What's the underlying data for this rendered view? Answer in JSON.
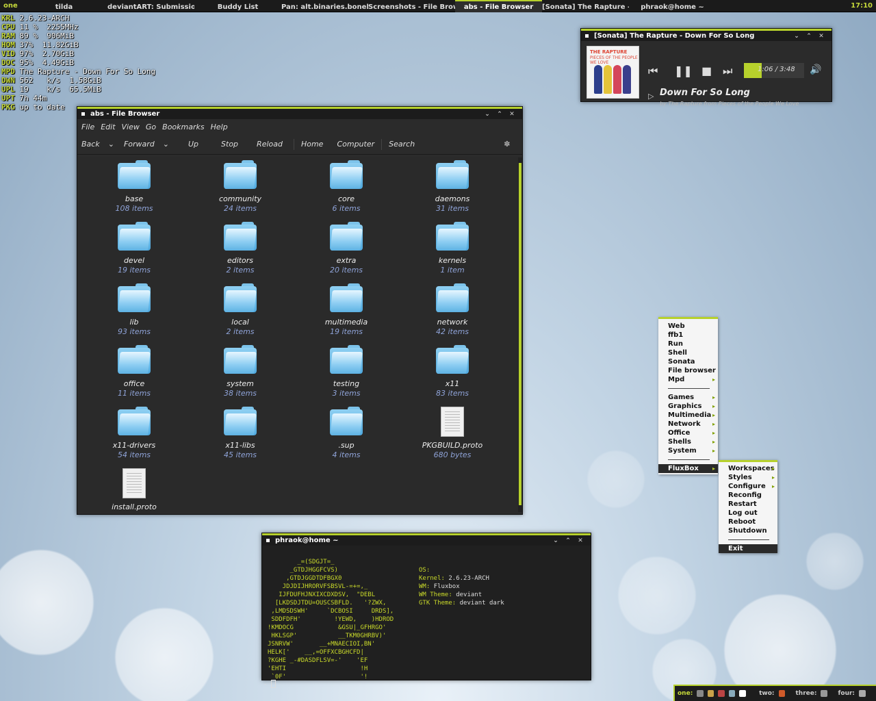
{
  "taskbar": {
    "workspace": "one",
    "tasks": [
      {
        "label": "tilda"
      },
      {
        "label": "deviantART: Submission -"
      },
      {
        "label": "Buddy List"
      },
      {
        "label": "Pan: alt.binaries.boneless"
      },
      {
        "label": "Screenshots - File Browser"
      },
      {
        "label": "abs - File Browser"
      },
      {
        "label": "[Sonata] The Rapture - Do"
      },
      {
        "label": "phraok@home ~"
      }
    ],
    "active_task": 5,
    "clock": "17:10",
    "accent": "#b7d12c"
  },
  "conky": [
    {
      "key": "KRL",
      "val": "2.6.23-ARCH"
    },
    {
      "key": "CPU",
      "val": "11 %  2255MHz"
    },
    {
      "key": "RAM",
      "val": "89 %  906MiB"
    },
    {
      "key": "HOM",
      "val": "37%  11.82GiB"
    },
    {
      "key": "VID",
      "val": "97%  2.70GiB"
    },
    {
      "key": "DOC",
      "val": "95%  4.49GiB"
    },
    {
      "key": "MPD",
      "val": "The Rapture - Down For So Long"
    },
    {
      "key": "DWN",
      "val": "562   k/s  1.58GiB"
    },
    {
      "key": "UPL",
      "val": "19    k/s  65.5MiB"
    },
    {
      "key": "UPT",
      "val": "7h 44m"
    },
    {
      "key": "PKG",
      "val": "up to date"
    }
  ],
  "file_browser": {
    "title": "abs - File Browser",
    "menu": [
      "File",
      "Edit",
      "View",
      "Go",
      "Bookmarks",
      "Help"
    ],
    "toolbar": {
      "back": "Back",
      "forward": "Forward",
      "up": "Up",
      "stop": "Stop",
      "reload": "Reload",
      "home": "Home",
      "computer": "Computer",
      "search": "Search"
    },
    "items": [
      {
        "name": "base",
        "count": "108 items",
        "type": "folder"
      },
      {
        "name": "community",
        "count": "24 items",
        "type": "folder"
      },
      {
        "name": "core",
        "count": "6 items",
        "type": "folder"
      },
      {
        "name": "daemons",
        "count": "31 items",
        "type": "folder"
      },
      {
        "name": "devel",
        "count": "19 items",
        "type": "folder"
      },
      {
        "name": "editors",
        "count": "2 items",
        "type": "folder"
      },
      {
        "name": "extra",
        "count": "20 items",
        "type": "folder"
      },
      {
        "name": "kernels",
        "count": "1 item",
        "type": "folder"
      },
      {
        "name": "lib",
        "count": "93 items",
        "type": "folder"
      },
      {
        "name": "local",
        "count": "2 items",
        "type": "folder"
      },
      {
        "name": "multimedia",
        "count": "19 items",
        "type": "folder"
      },
      {
        "name": "network",
        "count": "42 items",
        "type": "folder"
      },
      {
        "name": "office",
        "count": "11 items",
        "type": "folder"
      },
      {
        "name": "system",
        "count": "38 items",
        "type": "folder"
      },
      {
        "name": "testing",
        "count": "3 items",
        "type": "folder"
      },
      {
        "name": "x11",
        "count": "83 items",
        "type": "folder"
      },
      {
        "name": "x11-drivers",
        "count": "54 items",
        "type": "folder"
      },
      {
        "name": "x11-libs",
        "count": "45 items",
        "type": "folder"
      },
      {
        "name": ".sup",
        "count": "4 items",
        "type": "folder"
      },
      {
        "name": "PKGBUILD.proto",
        "count": "680 bytes",
        "type": "file"
      },
      {
        "name": "install.proto",
        "count": "",
        "type": "file"
      }
    ]
  },
  "sonata": {
    "title": "[Sonata] The Rapture - Down For So Long",
    "time": "1:06 / 3:48",
    "progress_fraction": 0.29,
    "song": "Down For So Long",
    "sub": "by The Rapture from Pieces of the People We Love",
    "art_band": "THE RAPTURE",
    "art_album": "PIECES OF THE PEOPLE WE LOVE"
  },
  "terminal": {
    "title": "phraok@home ~",
    "ascii": [
      "        _=(SDGJT=_",
      "      _GTDJHGGFCVS)",
      "     ,GTDJGGDTDFBGX0",
      "    JDJDIJHRORVFSBSVL-=+=,_",
      "   IJFDUFHJNXIXCDXDSV,  \"DEBL",
      "  [LKDSDJTDU=OUSCSBFLD.   '?ZWX,",
      " ,LMDSDSWH'     `DCBOSI     DRDS],",
      " SDDFDFH'         !YEWD,    )HDROD",
      "!KMDOCG            &GSU|_GFHRGO'",
      " HKLSGP'           __TKM0GHRBV)'",
      "JSNRVW'       __+MNAECIOI,BN'",
      "HELK['    __,=OFFXCBGHCFD|",
      "?KGHE _-#DASDFLSV=-'    'EF",
      "'EHTI                    !H",
      " `0F'                    '!"
    ],
    "info": [
      {
        "label": "OS:",
        "value": ""
      },
      {
        "label": "Kernel:",
        "value": "2.6.23-ARCH"
      },
      {
        "label": "WM:",
        "value": "Fluxbox"
      },
      {
        "label": "WM Theme:",
        "value": "deviant"
      },
      {
        "label": "GTK Theme:",
        "value": "deviant dark"
      }
    ],
    "prompt": "-"
  },
  "root_menu": {
    "items": [
      {
        "label": "Web",
        "sub": false
      },
      {
        "label": "ffb1",
        "sub": false
      },
      {
        "label": "Run",
        "sub": false
      },
      {
        "label": "Shell",
        "sub": false
      },
      {
        "label": "Sonata",
        "sub": false
      },
      {
        "label": "File browser",
        "sub": false
      },
      {
        "label": "Mpd",
        "sub": true
      },
      {
        "sep": true
      },
      {
        "label": "Games",
        "sub": true
      },
      {
        "label": "Graphics",
        "sub": true
      },
      {
        "label": "Multimedia",
        "sub": true
      },
      {
        "label": "Network",
        "sub": true
      },
      {
        "label": "Office",
        "sub": true
      },
      {
        "label": "Shells",
        "sub": true
      },
      {
        "label": "System",
        "sub": true
      },
      {
        "sep": true
      },
      {
        "label": "FluxBox",
        "sub": true,
        "highlight": true
      }
    ]
  },
  "fluxbox_menu": {
    "items": [
      {
        "label": "Workspaces",
        "sub": true
      },
      {
        "label": "Styles",
        "sub": true
      },
      {
        "label": "Configure",
        "sub": true
      },
      {
        "label": "Reconfig",
        "sub": false
      },
      {
        "label": "Restart",
        "sub": false
      },
      {
        "label": "Log out",
        "sub": false
      },
      {
        "label": "Reboot",
        "sub": false
      },
      {
        "label": "Shutdown",
        "sub": false
      },
      {
        "sep": true
      },
      {
        "label": "Exit",
        "sub": false,
        "highlight": true
      }
    ]
  },
  "pager": {
    "workspaces": [
      {
        "label": "one:",
        "current": true,
        "icons": [
          "#888",
          "#c9a24a",
          "#b44",
          "#8ab",
          "#fff"
        ]
      },
      {
        "label": "two:",
        "current": false,
        "icons": [
          "#d05a2a"
        ]
      },
      {
        "label": "three:",
        "current": false,
        "icons": [
          "#999"
        ]
      },
      {
        "label": "four:",
        "current": false,
        "icons": [
          "#aaa"
        ]
      }
    ]
  }
}
